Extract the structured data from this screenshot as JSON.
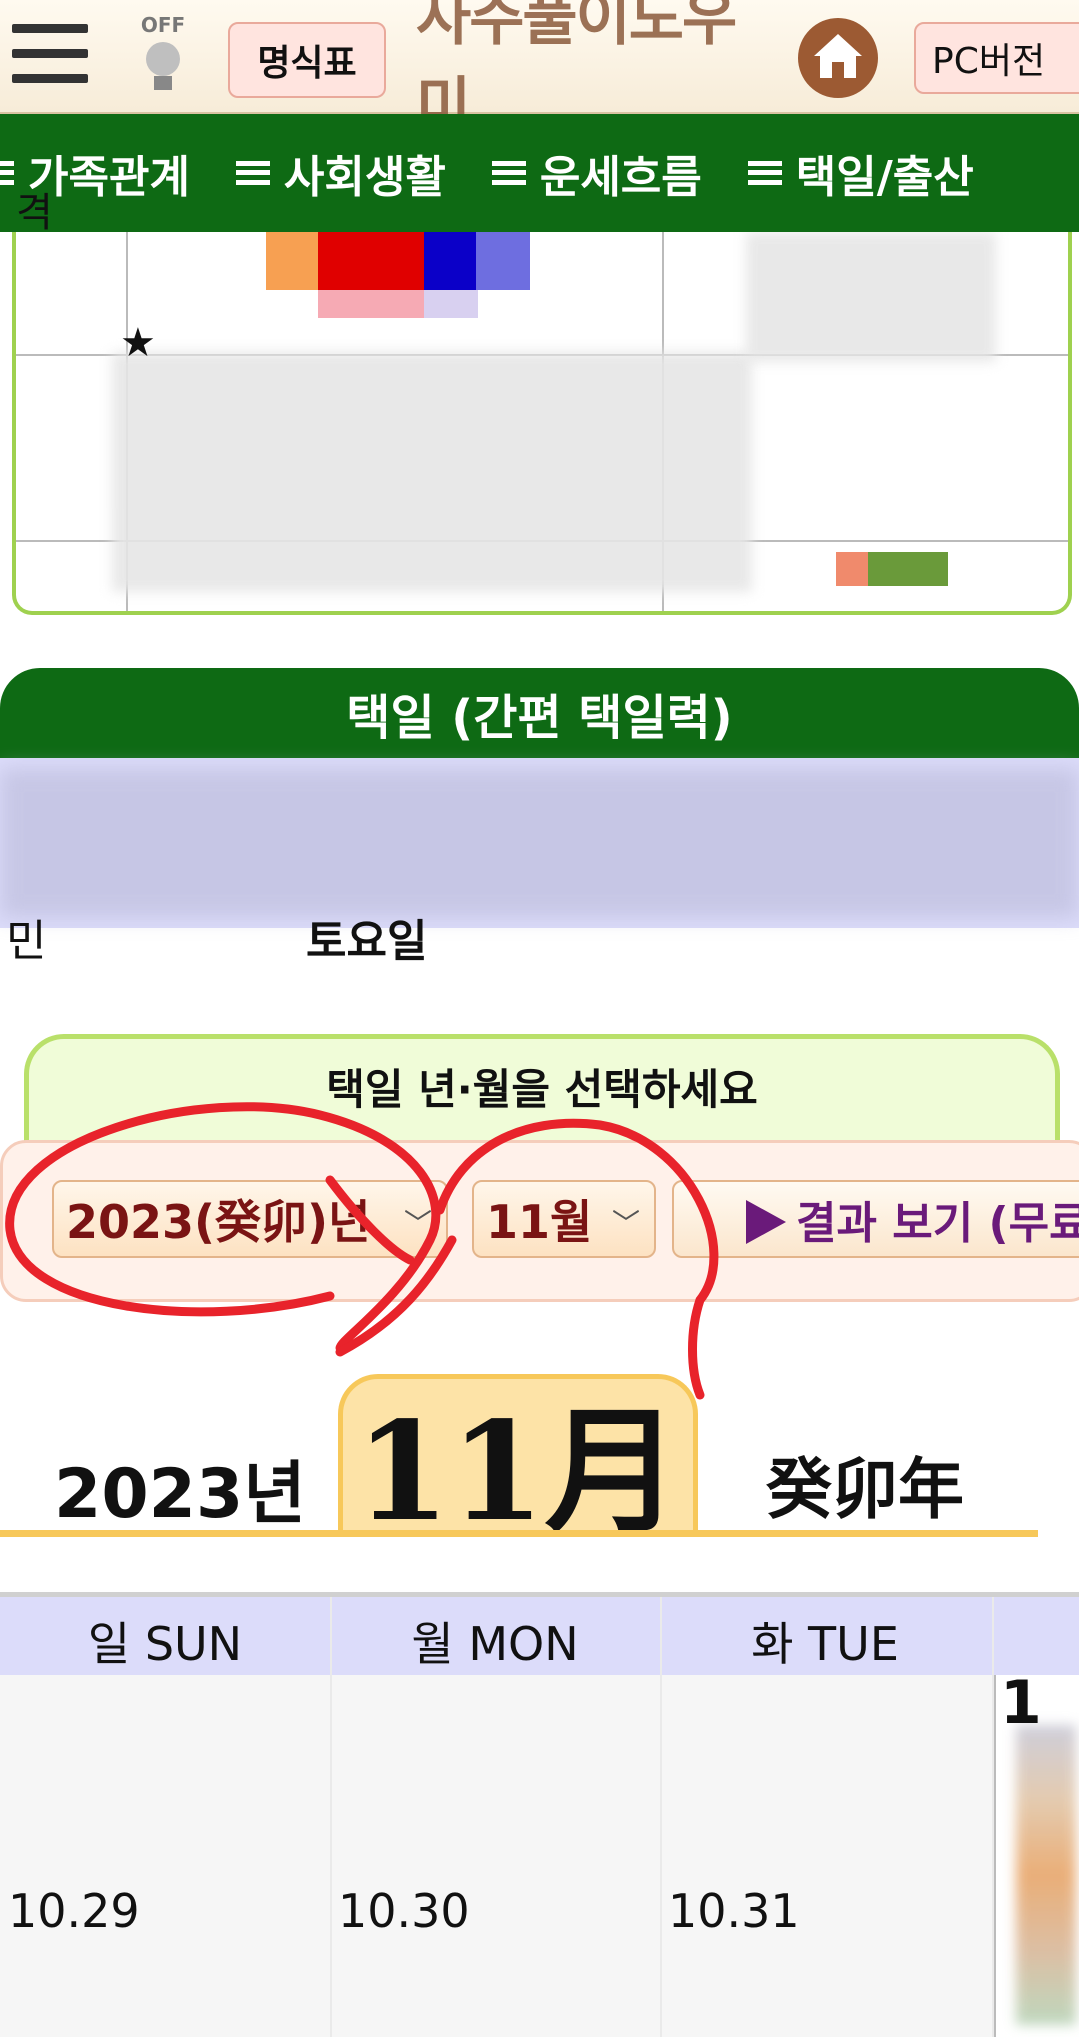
{
  "header": {
    "menu_icon": "hamburger-menu-icon",
    "bulb_label": "OFF",
    "myeongsik_label": "명식표",
    "logo_text": "사주풀이도우미",
    "home_icon": "home-icon",
    "pc_label": "PC버전"
  },
  "nav": {
    "items": [
      "가족관계",
      "사회생활",
      "운세흐름",
      "택일/출산"
    ]
  },
  "top_table": {
    "gyeok_label": "격",
    "star": "★"
  },
  "taekil": {
    "title": "택일 (간편 택일력)",
    "day_label": "토요일",
    "min_label": "민"
  },
  "select": {
    "title": "택일 년·월을 선택하세요",
    "year_value": "2023(癸卯)년",
    "month_value": "11월",
    "result_label": "결과 보기 (무료"
  },
  "calendar": {
    "year": "2023년",
    "month": "11月",
    "ganji": "癸卯年",
    "days": [
      "일 SUN",
      "월 MON",
      "화 TUE"
    ],
    "dates": [
      "10.29",
      "10.30",
      "10.31"
    ],
    "first_day": "1"
  }
}
